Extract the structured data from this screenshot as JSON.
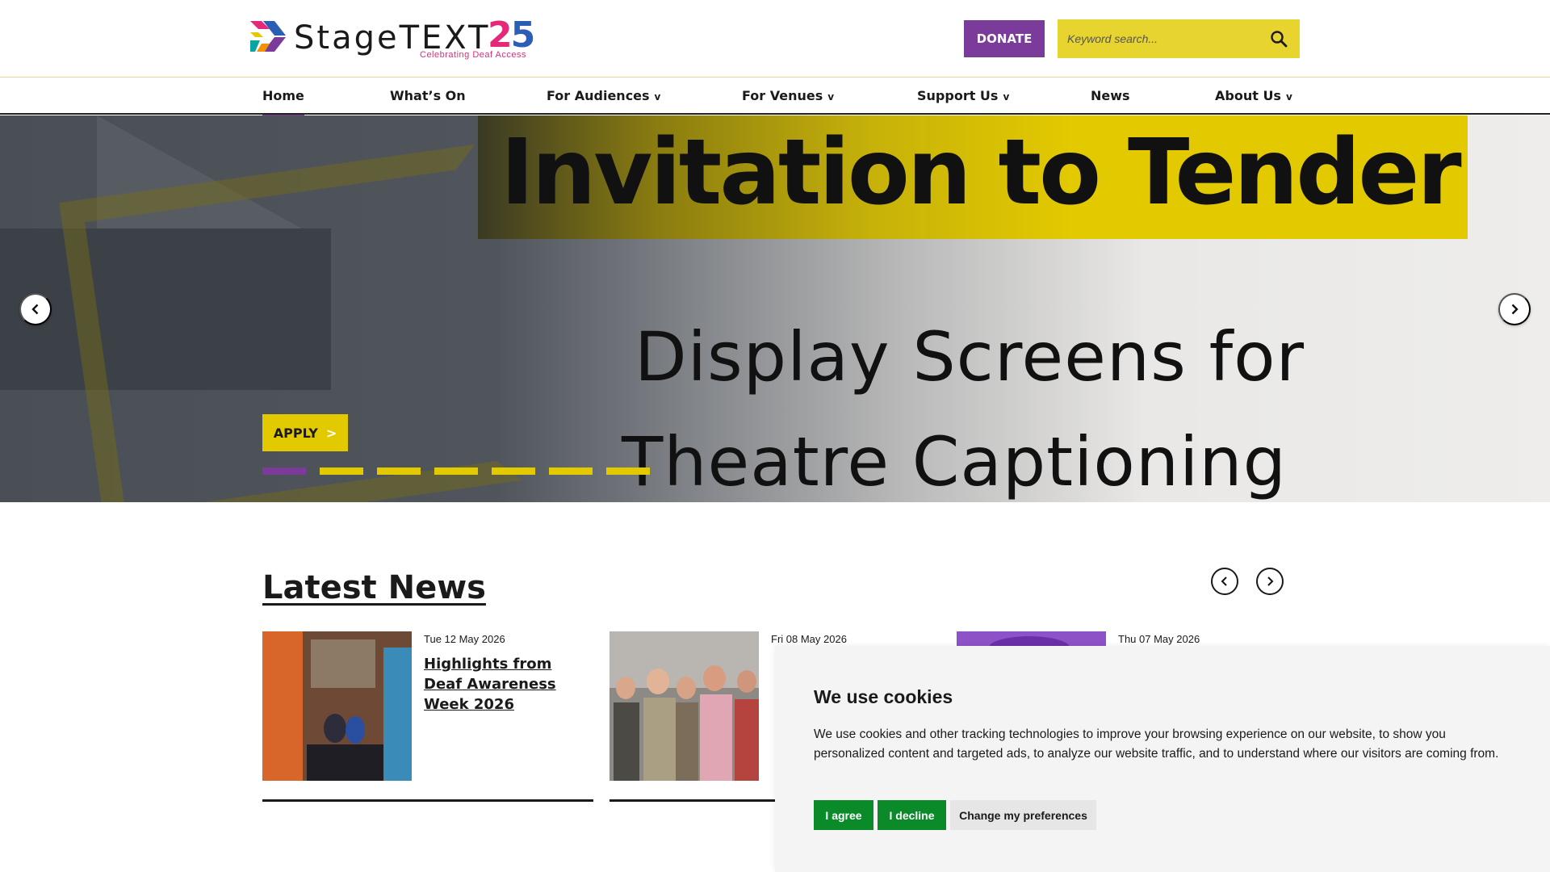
{
  "header": {
    "logo_wordmark": "StageTEXT",
    "logo_number_a": "2",
    "logo_number_b": "5",
    "logo_tagline": "Celebrating Deaf Access",
    "donate_label": "DONATE",
    "search_placeholder": "Keyword search...",
    "search_icon": "search-icon"
  },
  "nav": {
    "items": [
      {
        "label": "Home",
        "dropdown": false,
        "active": true
      },
      {
        "label": "What’s On",
        "dropdown": false
      },
      {
        "label": "For Audiences",
        "dropdown": true
      },
      {
        "label": "For Venues",
        "dropdown": true
      },
      {
        "label": "Support Us",
        "dropdown": true
      },
      {
        "label": "News",
        "dropdown": false
      },
      {
        "label": "About Us",
        "dropdown": true
      }
    ],
    "chevron": "v"
  },
  "hero": {
    "title": "Invitation to Tender",
    "subtitle_line1": "Display Screens for",
    "subtitle_line2": "Theatre Captioning",
    "apply_label": "APPLY",
    "apply_arrow": ">",
    "slide_count": 7,
    "active_slide": 1
  },
  "news": {
    "title": "Latest News",
    "cards": [
      {
        "date": "Tue 12 May 2026",
        "headline": "Highlights from Deaf Awareness Week 2026"
      },
      {
        "date": "Fri 08 May 2026",
        "headline": ""
      },
      {
        "date": "Thu 07 May 2026",
        "headline": ""
      }
    ]
  },
  "cookie": {
    "title": "We use cookies",
    "text": "We use cookies and other tracking technologies to improve your browsing experience on our website, to show you personalized content and targeted ads, to analyze our website traffic, and to understand where our visitors are coming from.",
    "agree_label": "I agree",
    "decline_label": "I decline",
    "prefs_label": "Change my preferences"
  },
  "colors": {
    "brand_purple": "#7b3b9b",
    "brand_yellow": "#e2c900",
    "cookie_green": "#0b8a2a"
  }
}
